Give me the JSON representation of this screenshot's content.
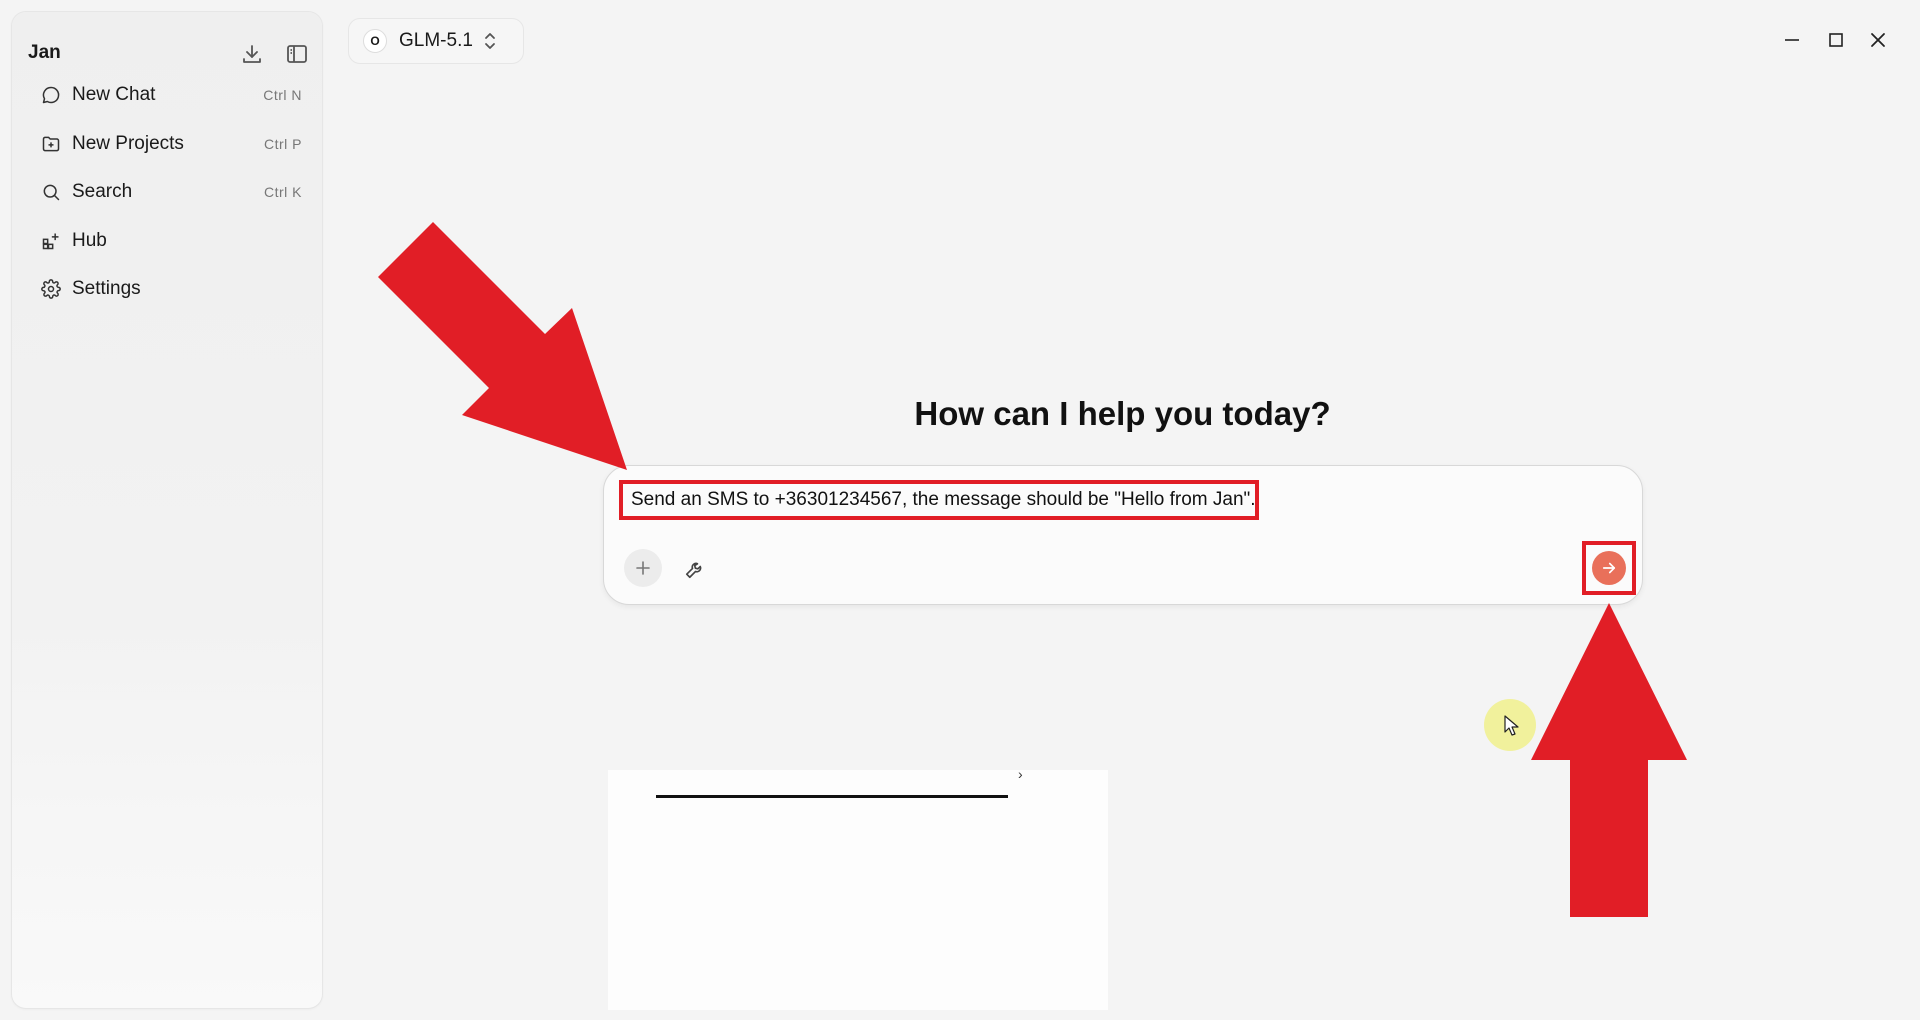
{
  "sidebar": {
    "app_name": "Jan",
    "items": [
      {
        "label": "New Chat",
        "shortcut": "Ctrl  N",
        "icon": "chat-bubble-icon"
      },
      {
        "label": "New Projects",
        "shortcut": "Ctrl  P",
        "icon": "folder-plus-icon"
      },
      {
        "label": "Search",
        "shortcut": "Ctrl  K",
        "icon": "search-icon"
      },
      {
        "label": "Hub",
        "shortcut": "",
        "icon": "grid-plus-icon"
      },
      {
        "label": "Settings",
        "shortcut": "",
        "icon": "gear-icon"
      }
    ]
  },
  "header": {
    "model_logo_letter": "O",
    "model_name": "GLM-5.1"
  },
  "main": {
    "greeting": "How can I help you today?",
    "input_value": "Send an SMS to +36301234567, the message should be \"Hello from Jan\"."
  },
  "colors": {
    "accent_send": "#e9705a",
    "annotation_red": "#e11e26"
  }
}
